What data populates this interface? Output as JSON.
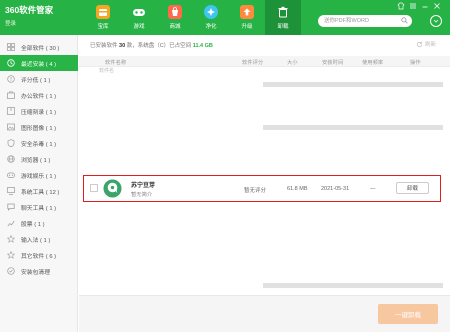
{
  "header": {
    "app_title": "360软件管家",
    "login_label": "登录",
    "nav": [
      {
        "label": "宝库",
        "icon": "treasure-box-icon",
        "color": "#f5a623"
      },
      {
        "label": "游戏",
        "icon": "gamepad-icon",
        "color": "#ffffff"
      },
      {
        "label": "商城",
        "icon": "store-icon",
        "color": "#ff6a4d"
      },
      {
        "label": "净化",
        "icon": "purify-icon",
        "color": "#3ec5f0"
      },
      {
        "label": "升级",
        "icon": "upgrade-icon",
        "color": "#ff8a3d"
      },
      {
        "label": "卸载",
        "icon": "uninstall-icon",
        "color": "#ffffff"
      }
    ],
    "active_nav": "卸载",
    "search_placeholder": "送你PDF和WORD",
    "accent_color": "#26b245"
  },
  "sidebar": {
    "items": [
      {
        "label": "全部软件 ( 30 )",
        "icon": "grid-icon"
      },
      {
        "label": "最近安装 ( 4 )",
        "icon": "clock-icon",
        "active": true
      },
      {
        "label": "评分低 ( 1 )",
        "icon": "low-rating-icon"
      },
      {
        "label": "办公软件 ( 1 )",
        "icon": "office-icon"
      },
      {
        "label": "压缩刻录 ( 1 )",
        "icon": "compress-icon"
      },
      {
        "label": "图形图像 ( 1 )",
        "icon": "image-icon"
      },
      {
        "label": "安全杀毒 ( 1 )",
        "icon": "shield-icon"
      },
      {
        "label": "浏览器 ( 1 )",
        "icon": "browser-icon"
      },
      {
        "label": "游戏娱乐 ( 1 )",
        "icon": "game-icon"
      },
      {
        "label": "系统工具 ( 12 )",
        "icon": "system-tool-icon"
      },
      {
        "label": "聊天工具 ( 1 )",
        "icon": "chat-icon"
      },
      {
        "label": "股票 ( 1 )",
        "icon": "stock-icon"
      },
      {
        "label": "输入法 ( 1 )",
        "icon": "input-method-icon"
      },
      {
        "label": "其它软件 ( 6 )",
        "icon": "other-software-icon"
      },
      {
        "label": "安装包清理",
        "icon": "package-cleanup-icon"
      }
    ]
  },
  "main": {
    "summary": {
      "prefix": "已安装软件",
      "count": "30",
      "middle": "款，系统盘（C）已占空间",
      "size": "11.4 GB"
    },
    "refresh_label": "刷新",
    "columns": [
      "软件名称",
      "软件评分",
      "大小",
      "安装时间",
      "使用频率",
      "操作"
    ],
    "partial_row_text": "软件名",
    "row": {
      "name": "苏宁豆芽",
      "description": "暂无简介",
      "rating": "暂无评分",
      "size": "61.8 MB",
      "install_date": "2021-05-31",
      "frequency": "—",
      "action_label": "卸载",
      "icon": "suning-douya-app-icon"
    },
    "onekey_uninstall_label": "一键卸载",
    "highlight_color": "#e02020"
  }
}
